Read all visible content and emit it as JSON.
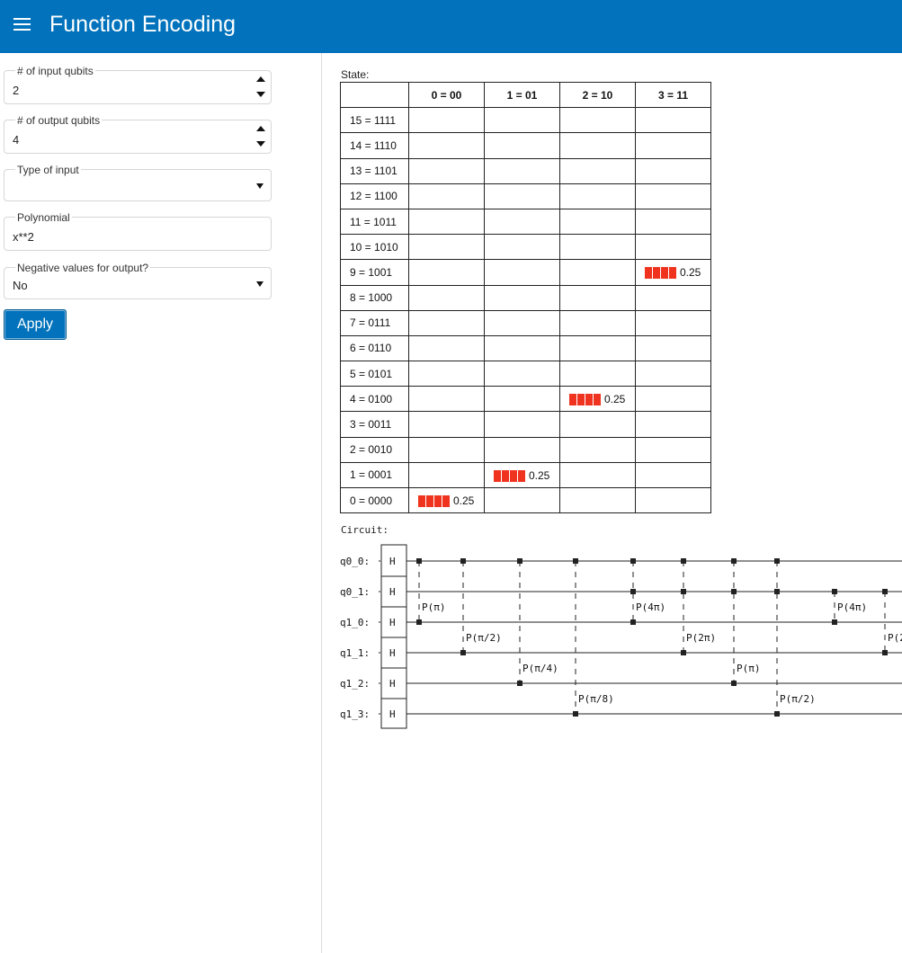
{
  "app": {
    "title": "Function Encoding"
  },
  "form": {
    "input_qubits": {
      "label": "# of input qubits",
      "value": "2"
    },
    "output_qubits": {
      "label": "# of output qubits",
      "value": "4"
    },
    "input_type": {
      "label": "Type of input",
      "value": ""
    },
    "polynomial": {
      "label": "Polynomial",
      "value": "x**2"
    },
    "negative": {
      "label": "Negative values for output?",
      "value": "No"
    },
    "apply_label": "Apply"
  },
  "state": {
    "label": "State:",
    "columns": [
      "0 = 00",
      "1 = 01",
      "2 = 10",
      "3 = 11"
    ],
    "rows": [
      "15 = 1111",
      "14 = 1110",
      "13 = 1101",
      "12 = 1100",
      "11 = 1011",
      "10 = 1010",
      "9 = 1001",
      "8 = 1000",
      "7 = 0111",
      "6 = 0110",
      "5 = 0101",
      "4 = 0100",
      "3 = 0011",
      "2 = 0010",
      "1 = 0001",
      "0 = 0000"
    ],
    "amplitudes": [
      {
        "row": "9 = 1001",
        "col": "3 = 11",
        "value": "0.25",
        "prob": 0.25
      },
      {
        "row": "4 = 0100",
        "col": "2 = 10",
        "value": "0.25",
        "prob": 0.25
      },
      {
        "row": "1 = 0001",
        "col": "1 = 01",
        "value": "0.25",
        "prob": 0.25
      },
      {
        "row": "0 = 0000",
        "col": "0 = 00",
        "value": "0.25",
        "prob": 0.25
      }
    ],
    "bar_color": "#f0331f"
  },
  "circuit": {
    "label": "Circuit:",
    "wires": [
      "q0_0:",
      "q0_1:",
      "q1_0:",
      "q1_1:",
      "q1_2:",
      "q1_3:"
    ],
    "h_gate_label": "H",
    "gates": [
      {
        "label": "P(π)",
        "control": "q0_0:",
        "target": "q1_0:"
      },
      {
        "label": "P(π/2)",
        "control": "q0_0:",
        "target": "q1_1:"
      },
      {
        "label": "P(π/4)",
        "control": "q0_0:",
        "target": "q1_2:"
      },
      {
        "label": "P(π/8)",
        "control": "q0_0:",
        "target": "q1_3:"
      },
      {
        "label": "P(4π)",
        "controls": [
          "q0_0:",
          "q0_1:"
        ],
        "target": "q1_0:"
      },
      {
        "label": "P(2π)",
        "controls": [
          "q0_0:",
          "q0_1:"
        ],
        "target": "q1_1:"
      },
      {
        "label": "P(π)",
        "controls": [
          "q0_0:",
          "q0_1:"
        ],
        "target": "q1_2:"
      },
      {
        "label": "P(π/2)",
        "controls": [
          "q0_0:",
          "q0_1:"
        ],
        "target": "q1_3:"
      },
      {
        "label": "P(4π)",
        "control": "q0_1:",
        "target": "q1_0:"
      },
      {
        "label": "P(2",
        "control": "q0_1:",
        "target": "q1_1:"
      }
    ]
  }
}
